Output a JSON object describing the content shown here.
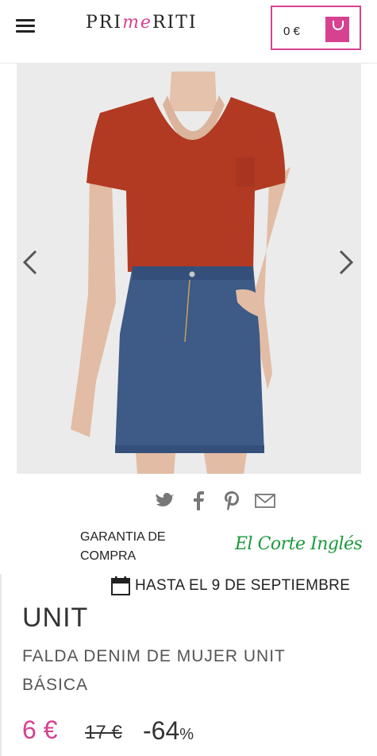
{
  "header": {
    "logo_text_1": "PRI",
    "logo_text_accent": "me",
    "logo_text_2": "RITI",
    "cart_amount": "0 €"
  },
  "colors": {
    "brand_pink": "#d6428f",
    "eci_green": "#1a9a3c"
  },
  "share": {
    "icons": [
      "twitter-icon",
      "facebook-icon",
      "pinterest-icon",
      "mail-icon"
    ]
  },
  "guarantee": {
    "text": "GARANTIA DE COMPRA",
    "partner": "El Corte Inglés"
  },
  "offer": {
    "until": "HASTA EL 9 DE SEPTIEMBRE"
  },
  "product": {
    "brand": "UNIT",
    "name": "FALDA DENIM DE MUJER UNIT BÁSICA",
    "price": "6 €",
    "old_price": "17 €",
    "discount_value": "-64",
    "discount_unit": "%"
  }
}
